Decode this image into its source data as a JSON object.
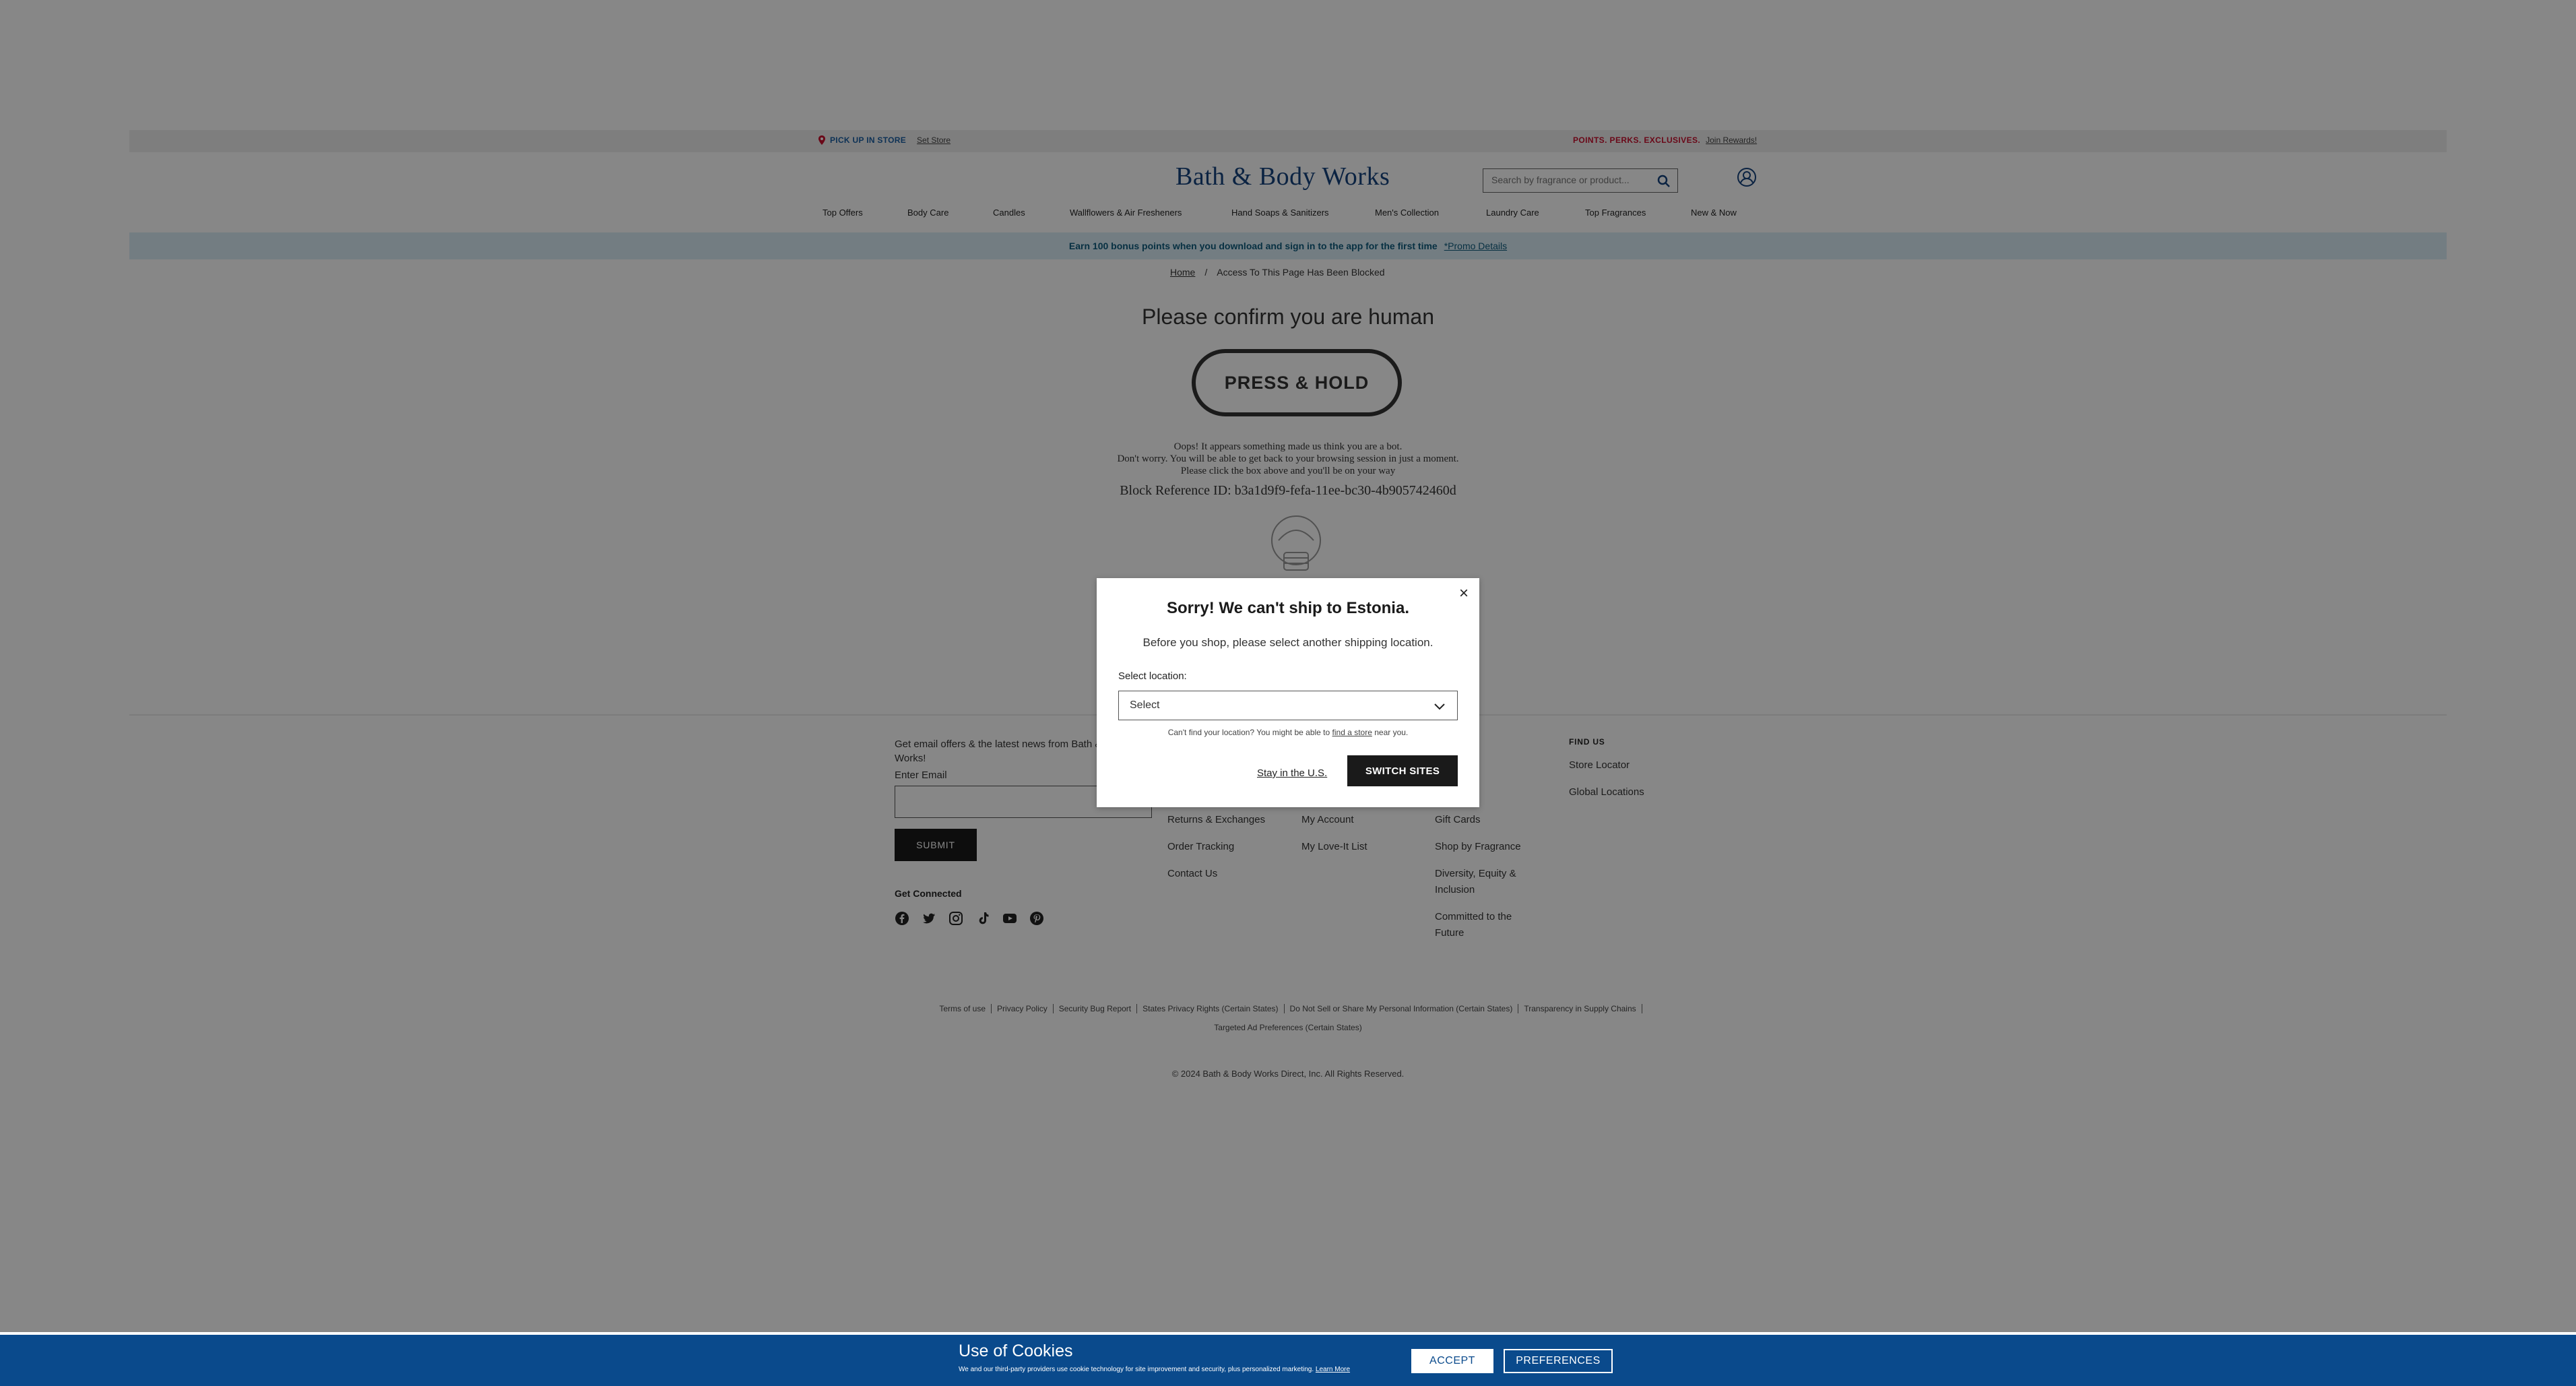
{
  "utility_bar": {
    "pickup_label": "PICK UP IN STORE",
    "set_store": "Set Store",
    "perks": "POINTS. PERKS. EXCLUSIVES.",
    "join": "Join Rewards!"
  },
  "header": {
    "logo": "Bath & Body Works",
    "search_placeholder": "Search by fragrance or product..."
  },
  "nav": {
    "items": [
      "Top Offers",
      "Body Care",
      "Candles",
      "Wallflowers & Air Fresheners",
      "Hand Soaps & Sanitizers",
      "Men's Collection",
      "Laundry Care",
      "Top Fragrances",
      "New & Now"
    ]
  },
  "promo": {
    "text": "Earn 100 bonus points when you download and sign in to the app for the first time",
    "link": "*Promo Details"
  },
  "breadcrumb": {
    "home": "Home",
    "separator": "/",
    "current": "Access To This Page Has Been Blocked"
  },
  "human_check": {
    "title": "Please confirm you are human",
    "button": "PRESS & HOLD",
    "line1": "Oops! It appears something made us think you are a bot.",
    "line2": "Don't worry. You will be able to get back to your browsing session in just a moment.",
    "line3": "Please click the box above and you'll be on your way",
    "block_ref": "Block Reference ID: b3a1d9f9-fefa-11ee-bc30-4b905742460d"
  },
  "footer": {
    "email_offers": "Get email offers & the latest news from Bath & Body Works!",
    "email_label": "Enter Email",
    "submit": "SUBMIT",
    "get_connected": "Get Connected",
    "col1": [
      "Returns & Exchanges",
      "Order Tracking",
      "Contact Us"
    ],
    "col2": [
      "My Account",
      "My Love-It List"
    ],
    "col3": [
      "Gift Cards",
      "Shop by Fragrance",
      "Diversity, Equity & Inclusion",
      "Committed to the Future"
    ],
    "find_us": {
      "heading": "FIND US",
      "links": [
        "Store Locator",
        "Global Locations"
      ]
    },
    "legal_links": [
      "Terms of use",
      "Privacy Policy",
      "Security Bug Report",
      "States Privacy Rights (Certain States)",
      "Do Not Sell or Share My Personal Information (Certain States)",
      "Transparency in Supply Chains"
    ],
    "legal_link_2": "Targeted Ad Preferences (Certain States)",
    "copyright": "© 2024 Bath & Body Works Direct, Inc. All Rights Reserved."
  },
  "modal": {
    "title": "Sorry! We can't ship to Estonia.",
    "subtitle": "Before you shop, please select another shipping location.",
    "select_label": "Select location:",
    "select_value": "Select",
    "help_prefix": "Can't find your location? You might be able to ",
    "help_link": "find a store",
    "help_suffix": " near you.",
    "stay": "Stay in the U.S.",
    "switch": "SWITCH SITES",
    "close": "×"
  },
  "cookies": {
    "title": "Use of Cookies",
    "text": "We and our third-party providers use cookie technology for site improvement and security, plus personalized marketing.",
    "learn_more": "Learn More",
    "accept": "ACCEPT",
    "preferences": "PREFERENCES"
  },
  "colors": {
    "brand_blue": "#15427d",
    "promo_bg": "#d9ecf5",
    "cookie_bg": "#0a4a8c",
    "perks_red": "#c8102e"
  }
}
